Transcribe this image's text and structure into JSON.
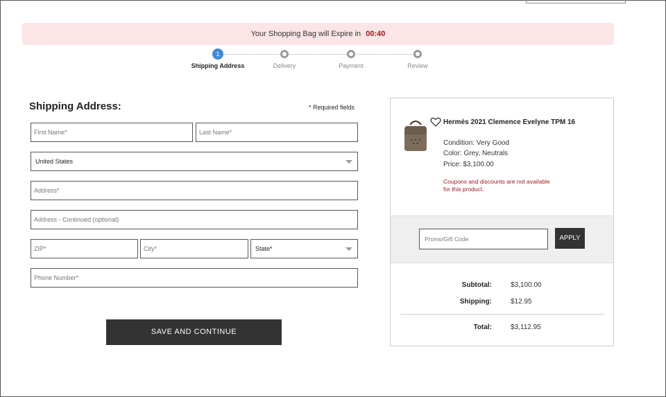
{
  "expire_bar": {
    "text": "Your Shopping Bag will Expire in",
    "timer": "00:40"
  },
  "steps": [
    {
      "number": "1",
      "label": "Shipping Address",
      "active": true
    },
    {
      "label": "Delivery",
      "active": false
    },
    {
      "label": "Payment",
      "active": false
    },
    {
      "label": "Review",
      "active": false
    }
  ],
  "form": {
    "title": "Shipping Address:",
    "required_note": "* Required fields",
    "first_name_placeholder": "First Name*",
    "last_name_placeholder": "Last Name*",
    "country_value": "United States",
    "address_placeholder": "Address*",
    "address2_placeholder": "Address - Continued (optional)",
    "zip_placeholder": "ZIP*",
    "city_placeholder": "City*",
    "state_placeholder": "State*",
    "phone_placeholder": "Phone Number*",
    "save_label": "SAVE AND CONTINUE"
  },
  "summary": {
    "product_name": "Hermès 2021 Clemence Evelyne TPM 16",
    "condition": "Condition: Very Good",
    "color": "Color: Grey, Neutrals",
    "price": "Price: $3,100.00",
    "warning": "Coupons and discounts are not available for this product.",
    "promo_placeholder": "Promo/Gift Code",
    "apply_label": "APPLY",
    "subtotal_label": "Subtotal:",
    "subtotal_value": "$3,100.00",
    "shipping_label": "Shipping:",
    "shipping_value": "$12.95",
    "total_label": "Total:",
    "total_value": "$3,112.95"
  },
  "colors": {
    "accent": "#3c8ad9",
    "warning": "#a0191f",
    "button": "#333333",
    "banner_bg": "#fbe5e6"
  },
  "icons": {
    "heart": "heart-icon",
    "product": "bag-image"
  }
}
